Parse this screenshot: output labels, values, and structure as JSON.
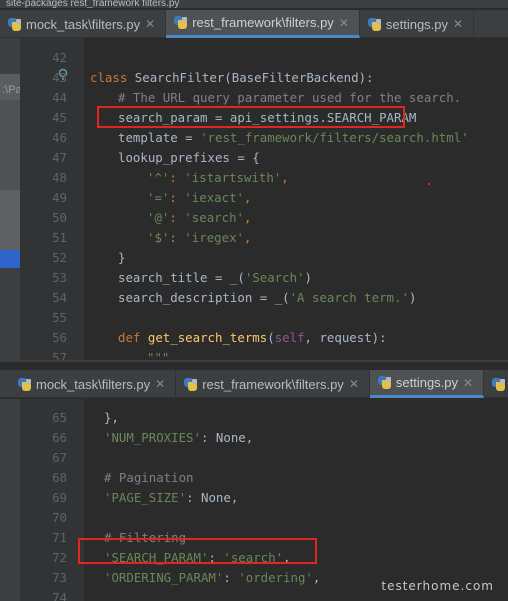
{
  "top_pane": {
    "breadcrumb": "site-packages  rest_framework  filters.py",
    "tabs": [
      {
        "label": "mock_task\\filters.py",
        "active": false
      },
      {
        "label": "rest_framework\\filters.py",
        "active": true
      },
      {
        "label": "settings.py",
        "active": false
      }
    ],
    "left_strip_text": ":\\Pa",
    "lines": [
      {
        "num": "42"
      },
      {
        "num": "43"
      },
      {
        "num": "44"
      },
      {
        "num": "45"
      },
      {
        "num": "46"
      },
      {
        "num": "47"
      },
      {
        "num": "48"
      },
      {
        "num": "49"
      },
      {
        "num": "50"
      },
      {
        "num": "51"
      },
      {
        "num": "52"
      },
      {
        "num": "53"
      },
      {
        "num": "54"
      },
      {
        "num": "55"
      },
      {
        "num": "56"
      },
      {
        "num": "57"
      }
    ],
    "code": {
      "l43_kw": "class",
      "l43_rest": " SearchFilter(BaseFilterBackend):",
      "l44": "# The URL query parameter used for the search.",
      "l45": "search_param = api_settings.SEARCH_PARAM",
      "l46_a": "template = ",
      "l46_s": "'rest_framework/filters/search.html'",
      "l47": "lookup_prefixes = {",
      "l48_k": "'^'",
      "l48_v": "'istartswith'",
      "l49_k": "'='",
      "l49_v": "'iexact'",
      "l50_k": "'@'",
      "l50_v": "'search'",
      "l51_k": "'$'",
      "l51_v": "'iregex'",
      "l52": "}",
      "l54_a": "search_title = _(",
      "l54_s": "'Search'",
      "l54_b": ")",
      "l55_a": "search_description = _(",
      "l55_s": "'A search term.'",
      "l55_b": ")",
      "l57_kw": "def",
      "l57_fn": "get_search_terms",
      "l57_self": "self",
      "l57_rest": ", request):",
      "l58": "\"\"\""
    }
  },
  "bottom_pane": {
    "tabs": [
      {
        "label": "mock_task\\filters.py",
        "active": false
      },
      {
        "label": "rest_framework\\filters.py",
        "active": false
      },
      {
        "label": "settings.py",
        "active": true
      }
    ],
    "lines": [
      {
        "num": "65"
      },
      {
        "num": "66"
      },
      {
        "num": "67"
      },
      {
        "num": "68"
      },
      {
        "num": "69"
      },
      {
        "num": "70"
      },
      {
        "num": "71"
      },
      {
        "num": "72"
      },
      {
        "num": "73"
      },
      {
        "num": "74"
      }
    ],
    "code": {
      "l65": "},",
      "l66_s": "'NUM_PROXIES'",
      "l66_b": ": None,",
      "l68": "# Pagination",
      "l69_s": "'PAGE_SIZE'",
      "l69_b": ": None,",
      "l71": "# Filtering",
      "l72_s": "'SEARCH_PARAM'",
      "l72_m": ": ",
      "l72_v": "'search'",
      "l72_b": ",",
      "l73_s": "'ORDERING_PARAM'",
      "l73_m": ": ",
      "l73_v": "'ordering'",
      "l73_b": ","
    }
  },
  "watermark": "testerhome.com"
}
